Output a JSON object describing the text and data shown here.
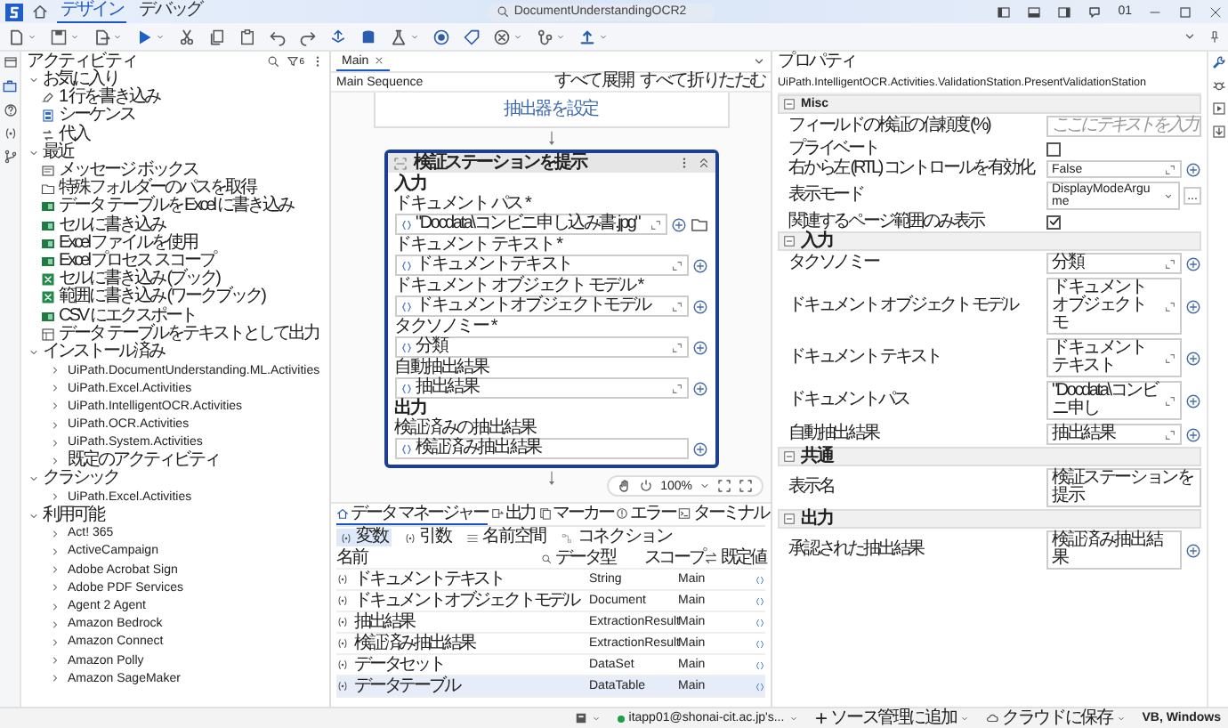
{
  "title_bar": {
    "tabs": [
      {
        "label": "デザイン",
        "selected": true
      },
      {
        "label": "デバッグ",
        "selected": false
      }
    ],
    "search": {
      "value": "DocumentUnderstandingOCR2"
    },
    "user_initials": "01"
  },
  "activities": {
    "title": "アクティビティ",
    "filter_count": "6",
    "tree": [
      {
        "label": "お気に入り",
        "expanded": true,
        "children": [
          {
            "label": "1 行を書き込み",
            "kind": "write-line"
          },
          {
            "label": "シーケンス",
            "kind": "sequence"
          },
          {
            "label": "代入",
            "kind": "assign"
          }
        ]
      },
      {
        "label": "最近",
        "expanded": true,
        "children": [
          {
            "label": "メッセージ ボックス",
            "kind": "message"
          },
          {
            "label": "特殊フォルダーのパスを取得",
            "kind": "folder"
          },
          {
            "label": "データ テーブルを Excel に書き込み",
            "kind": "excel"
          },
          {
            "label": "セルに書き込み",
            "kind": "excel"
          },
          {
            "label": "Excel ファイルを使用",
            "kind": "excel"
          },
          {
            "label": "Excel プロセス スコープ",
            "kind": "excel"
          },
          {
            "label": "セルに書き込み (ブック)",
            "kind": "workbook"
          },
          {
            "label": "範囲に書き込み (ワークブック)",
            "kind": "workbook"
          },
          {
            "label": "CSV にエクスポート",
            "kind": "excel"
          },
          {
            "label": "データ テーブルをテキストとして出力",
            "kind": "table-text"
          }
        ]
      },
      {
        "label": "インストール済み",
        "expanded": true,
        "children": [
          {
            "label": "UiPath.DocumentUnderstanding.ML.Activities",
            "kind": "package",
            "expanded": false
          },
          {
            "label": "UiPath.Excel.Activities",
            "kind": "package",
            "expanded": false
          },
          {
            "label": "UiPath.IntelligentOCR.Activities",
            "kind": "package",
            "expanded": false
          },
          {
            "label": "UiPath.OCR.Activities",
            "kind": "package",
            "expanded": false
          },
          {
            "label": "UiPath.System.Activities",
            "kind": "package",
            "expanded": false
          },
          {
            "label": "既定のアクティビティ",
            "kind": "package",
            "expanded": false
          }
        ]
      },
      {
        "label": "クラシック",
        "expanded": true,
        "children": [
          {
            "label": "UiPath.Excel.Activities",
            "kind": "package",
            "expanded": false
          }
        ]
      },
      {
        "label": "利用可能",
        "expanded": true,
        "children": [
          {
            "label": "Act! 365",
            "kind": "package",
            "expanded": false
          },
          {
            "label": "ActiveCampaign",
            "kind": "package",
            "expanded": false
          },
          {
            "label": "Adobe Acrobat Sign",
            "kind": "package",
            "expanded": false
          },
          {
            "label": "Adobe PDF Services",
            "kind": "package",
            "expanded": false
          },
          {
            "label": "Agent 2 Agent",
            "kind": "package",
            "expanded": false
          },
          {
            "label": "Amazon Bedrock",
            "kind": "package",
            "expanded": false
          },
          {
            "label": "Amazon Connect",
            "kind": "package",
            "expanded": false
          },
          {
            "label": "Amazon Polly",
            "kind": "package",
            "expanded": false
          },
          {
            "label": "Amazon SageMaker",
            "kind": "package",
            "expanded": false
          }
        ]
      }
    ]
  },
  "designer": {
    "tabs": [
      {
        "label": "Main",
        "selected": true
      }
    ],
    "breadcrumb": "Main Sequence",
    "expand_all": "すべて展開",
    "collapse_all": "すべて折りたたむ",
    "previous_activity": "抽出器を設定",
    "activity": {
      "title": "検証ステーションを提示",
      "sections": [
        {
          "label": "入力",
          "fields": [
            {
              "label": "ドキュメント パス *",
              "value": "\"Docdata\\コンビニ申し込み書.jpg\"",
              "expandable": true,
              "browse": true
            },
            {
              "label": "ドキュメント テキスト *",
              "value": "ドキュメントテキスト",
              "expandable": true,
              "browse": false
            },
            {
              "label": "ドキュメント オブジェクト モデル *",
              "value": "ドキュメントオブジェクトモデル",
              "expandable": true,
              "browse": false
            },
            {
              "label": "タクソノミー *",
              "value": "分類",
              "expandable": true,
              "browse": false
            },
            {
              "label": "自動抽出結果",
              "value": "抽出結果",
              "expandable": true,
              "browse": false
            }
          ]
        },
        {
          "label": "出力",
          "fields": [
            {
              "label": "検証済みの抽出結果",
              "value": "検証済み抽出結果",
              "expandable": false,
              "browse": false
            }
          ]
        }
      ]
    },
    "zoom": "100%",
    "data_manager": {
      "tabs": [
        {
          "label": "データ マネージャー",
          "kind": "data",
          "selected": true
        },
        {
          "label": "出力",
          "kind": "output",
          "selected": false
        },
        {
          "label": "マーカー",
          "kind": "marker",
          "selected": false
        },
        {
          "label": "エラー",
          "kind": "error",
          "selected": false
        },
        {
          "label": "ターミナル",
          "kind": "terminal",
          "selected": false
        }
      ],
      "subtabs": [
        {
          "label": "変数",
          "kind": "variables",
          "selected": true
        },
        {
          "label": "引数",
          "kind": "arguments",
          "selected": false
        },
        {
          "label": "名前空間",
          "kind": "namespaces",
          "selected": false
        },
        {
          "label": "コネクション",
          "kind": "connections",
          "selected": false
        }
      ],
      "table": {
        "columns": [
          "名前",
          "データ型",
          "スコープ",
          "既定値"
        ],
        "rows": [
          {
            "name": "ドキュメントテキスト",
            "type": "String",
            "scope": "Main",
            "selected": false
          },
          {
            "name": "ドキュメントオブジェクトモデル",
            "type": "Document",
            "scope": "Main",
            "selected": false
          },
          {
            "name": "抽出結果",
            "type": "ExtractionResult",
            "scope": "Main",
            "selected": false
          },
          {
            "name": "検証済み抽出結果",
            "type": "ExtractionResult",
            "scope": "Main",
            "selected": false
          },
          {
            "name": "データセット",
            "type": "DataSet",
            "scope": "Main",
            "selected": false
          },
          {
            "name": "データテーブル",
            "type": "DataTable",
            "scope": "Main",
            "selected": true
          }
        ]
      }
    }
  },
  "properties": {
    "title": "プロパティ",
    "type_name": "UiPath.IntelligentOCR.Activities.ValidationStation.PresentValidationStation",
    "categories": [
      {
        "label": "Misc",
        "expanded": true,
        "rows": [
          {
            "label": "フィールドの検証の信頼度 (%)",
            "kind": "text",
            "placeholder": "ここにテキストを入力"
          },
          {
            "label": "プライベート",
            "kind": "checkbox",
            "checked": false
          },
          {
            "label": "右から左 (RTL) コントロールを有効化",
            "kind": "expression",
            "value": "False"
          },
          {
            "label": "表示モード",
            "kind": "dropdown",
            "value": "DisplayModeArgume",
            "button": "..."
          },
          {
            "label": "関連するページ範囲のみ表示",
            "kind": "checkbox",
            "checked": true
          }
        ]
      },
      {
        "label": "入力",
        "expanded": true,
        "rows": [
          {
            "label": "タクソノミー",
            "kind": "expression",
            "value": "分類"
          },
          {
            "label": "ドキュメント オブジェクト モデル",
            "kind": "expression",
            "value": "ドキュメントオブジェクトモ"
          },
          {
            "label": "ドキュメント テキスト",
            "kind": "expression",
            "value": "ドキュメントテキスト"
          },
          {
            "label": "ドキュメントパス",
            "kind": "expression",
            "value": "\"Docdata\\コンビニ申し"
          },
          {
            "label": "自動抽出結果",
            "kind": "expression",
            "value": "抽出結果"
          }
        ]
      },
      {
        "label": "共通",
        "expanded": true,
        "rows": [
          {
            "label": "表示名",
            "kind": "text",
            "value": "検証ステーションを提示"
          }
        ]
      },
      {
        "label": "出力",
        "expanded": true,
        "rows": [
          {
            "label": "承認された抽出結果",
            "kind": "output",
            "value": "検証済み抽出結果"
          }
        ]
      }
    ]
  },
  "status_bar": {
    "account": "itapp01@shonai-cit.ac.jp's...",
    "source_control": "ソース管理に追加",
    "cloud": "クラウドに保存",
    "language": "VB, Windows"
  }
}
